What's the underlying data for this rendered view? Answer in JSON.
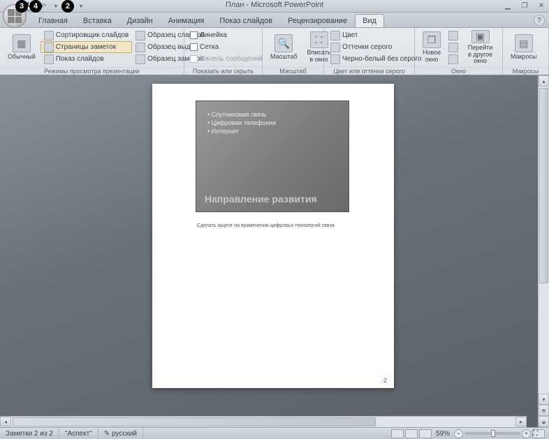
{
  "callouts": {
    "c2": "2",
    "c3": "3",
    "c4": "4"
  },
  "title": "План - Microsoft PowerPoint",
  "tabs": [
    "Главная",
    "Вставка",
    "Дизайн",
    "Анимация",
    "Показ слайдов",
    "Рецензирование",
    "Вид"
  ],
  "active_tab": 6,
  "ribbon": {
    "views": {
      "normal": "Обычный",
      "sorter": "Сортировщик слайдов",
      "notes_page": "Страницы заметок",
      "slideshow": "Показ слайдов",
      "master_slides": "Образец слайдов",
      "master_handouts": "Образец выдач",
      "master_notes": "Образец заметок",
      "group_label": "Режимы просмотра презентации"
    },
    "show": {
      "ruler": "Линейка",
      "grid": "Сетка",
      "msgbar": "Панель сообщений",
      "group_label": "Показать или скрыть"
    },
    "zoom": {
      "zoom": "Масштаб",
      "fit": "Вписать в окно",
      "group_label": "Масштаб"
    },
    "color": {
      "color": "Цвет",
      "grayscale": "Оттенки серого",
      "bw": "Черно-белый без серого",
      "group_label": "Цвет или оттенки серого"
    },
    "window": {
      "new": "Новое окно",
      "switch": "Перейти в другое окно",
      "group_label": "Окно"
    },
    "macros": {
      "macros": "Макросы",
      "group_label": "Макросы"
    }
  },
  "slide": {
    "bullets": [
      "Спутниковая связь",
      "Цифровая телефония",
      "Интернет"
    ],
    "title": "Направление развития",
    "note": "Сделать акцент на применении цифровых технологий связи.",
    "page_num": "2"
  },
  "status": {
    "counter": "Заметки 2 из 2",
    "theme": "\"Аспект\"",
    "lang": "русский",
    "zoom": "59%"
  }
}
